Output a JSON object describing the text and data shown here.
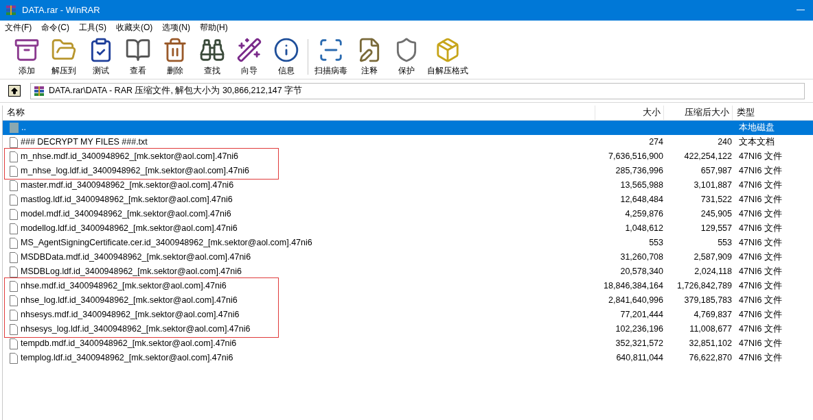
{
  "window": {
    "title": "DATA.rar - WinRAR"
  },
  "menu": [
    "文件(F)",
    "命令(C)",
    "工具(S)",
    "收藏夹(O)",
    "选项(N)",
    "帮助(H)"
  ],
  "toolbar": [
    {
      "label": "添加",
      "kind": "add"
    },
    {
      "label": "解压到",
      "kind": "extract"
    },
    {
      "label": "测试",
      "kind": "test"
    },
    {
      "label": "查看",
      "kind": "view"
    },
    {
      "label": "删除",
      "kind": "delete"
    },
    {
      "label": "查找",
      "kind": "find"
    },
    {
      "label": "向导",
      "kind": "wizard"
    },
    {
      "label": "信息",
      "kind": "info"
    },
    {
      "label": "扫描病毒",
      "kind": "scan"
    },
    {
      "label": "注释",
      "kind": "comment"
    },
    {
      "label": "保护",
      "kind": "protect"
    },
    {
      "label": "自解压格式",
      "kind": "sfx"
    }
  ],
  "address": "DATA.rar\\DATA - RAR 压缩文件, 解包大小为 30,866,212,147 字节",
  "table": {
    "columns": [
      "名称",
      "大小",
      "压缩后大小",
      "类型"
    ],
    "rows": [
      {
        "name": "..",
        "size": "",
        "packed": "",
        "type": "本地磁盘",
        "kind": "parent",
        "selected": true,
        "flagged": false
      },
      {
        "name": "### DECRYPT MY FILES ###.txt",
        "size": "274",
        "packed": "240",
        "type": "文本文档",
        "kind": "file",
        "selected": false,
        "flagged": false
      },
      {
        "name": "m_nhse.mdf.id_3400948962_[mk.sektor@aol.com].47ni6",
        "size": "7,636,516,900",
        "packed": "422,254,122",
        "type": "47NI6 文件",
        "kind": "file",
        "selected": false,
        "flagged": true
      },
      {
        "name": "m_nhse_log.ldf.id_3400948962_[mk.sektor@aol.com].47ni6",
        "size": "285,736,996",
        "packed": "657,987",
        "type": "47NI6 文件",
        "kind": "file",
        "selected": false,
        "flagged": true
      },
      {
        "name": "master.mdf.id_3400948962_[mk.sektor@aol.com].47ni6",
        "size": "13,565,988",
        "packed": "3,101,887",
        "type": "47NI6 文件",
        "kind": "file",
        "selected": false,
        "flagged": false
      },
      {
        "name": "mastlog.ldf.id_3400948962_[mk.sektor@aol.com].47ni6",
        "size": "12,648,484",
        "packed": "731,522",
        "type": "47NI6 文件",
        "kind": "file",
        "selected": false,
        "flagged": false
      },
      {
        "name": "model.mdf.id_3400948962_[mk.sektor@aol.com].47ni6",
        "size": "4,259,876",
        "packed": "245,905",
        "type": "47NI6 文件",
        "kind": "file",
        "selected": false,
        "flagged": false
      },
      {
        "name": "modellog.ldf.id_3400948962_[mk.sektor@aol.com].47ni6",
        "size": "1,048,612",
        "packed": "129,557",
        "type": "47NI6 文件",
        "kind": "file",
        "selected": false,
        "flagged": false
      },
      {
        "name": "MS_AgentSigningCertificate.cer.id_3400948962_[mk.sektor@aol.com].47ni6",
        "size": "553",
        "packed": "553",
        "type": "47NI6 文件",
        "kind": "file",
        "selected": false,
        "flagged": false
      },
      {
        "name": "MSDBData.mdf.id_3400948962_[mk.sektor@aol.com].47ni6",
        "size": "31,260,708",
        "packed": "2,587,909",
        "type": "47NI6 文件",
        "kind": "file",
        "selected": false,
        "flagged": false
      },
      {
        "name": "MSDBLog.ldf.id_3400948962_[mk.sektor@aol.com].47ni6",
        "size": "20,578,340",
        "packed": "2,024,118",
        "type": "47NI6 文件",
        "kind": "file",
        "selected": false,
        "flagged": false
      },
      {
        "name": "nhse.mdf.id_3400948962_[mk.sektor@aol.com].47ni6",
        "size": "18,846,384,164",
        "packed": "1,726,842,789",
        "type": "47NI6 文件",
        "kind": "file",
        "selected": false,
        "flagged": true
      },
      {
        "name": "nhse_log.ldf.id_3400948962_[mk.sektor@aol.com].47ni6",
        "size": "2,841,640,996",
        "packed": "379,185,783",
        "type": "47NI6 文件",
        "kind": "file",
        "selected": false,
        "flagged": true
      },
      {
        "name": "nhsesys.mdf.id_3400948962_[mk.sektor@aol.com].47ni6",
        "size": "77,201,444",
        "packed": "4,769,837",
        "type": "47NI6 文件",
        "kind": "file",
        "selected": false,
        "flagged": true
      },
      {
        "name": "nhsesys_log.ldf.id_3400948962_[mk.sektor@aol.com].47ni6",
        "size": "102,236,196",
        "packed": "11,008,677",
        "type": "47NI6 文件",
        "kind": "file",
        "selected": false,
        "flagged": true
      },
      {
        "name": "tempdb.mdf.id_3400948962_[mk.sektor@aol.com].47ni6",
        "size": "352,321,572",
        "packed": "32,851,102",
        "type": "47NI6 文件",
        "kind": "file",
        "selected": false,
        "flagged": false
      },
      {
        "name": "templog.ldf.id_3400948962_[mk.sektor@aol.com].47ni6",
        "size": "640,811,044",
        "packed": "76,622,870",
        "type": "47NI6 文件",
        "kind": "file",
        "selected": false,
        "flagged": false
      }
    ]
  }
}
